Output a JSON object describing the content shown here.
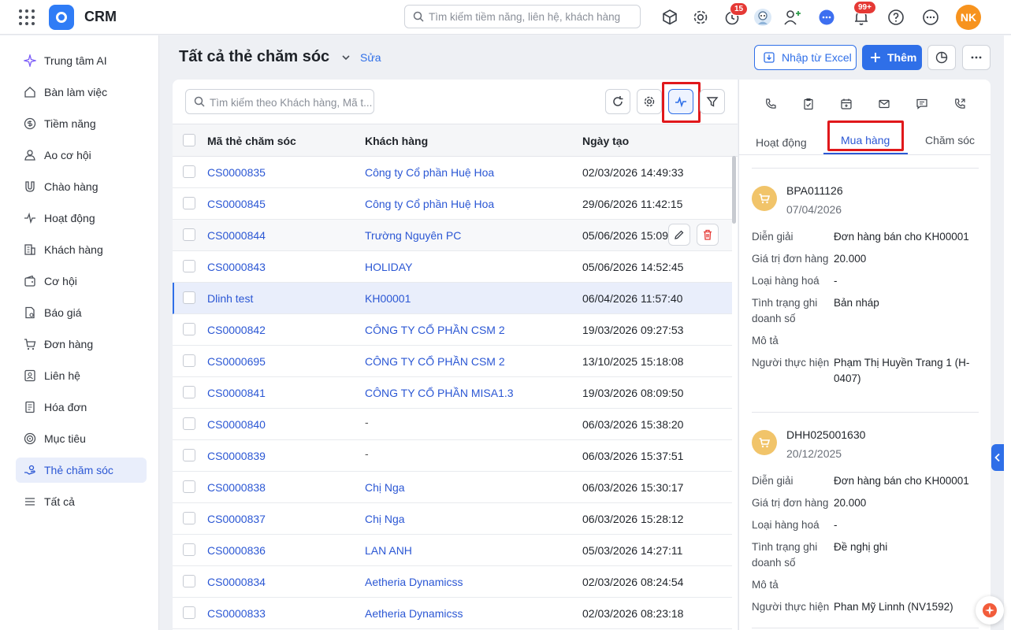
{
  "app": {
    "title": "CRM",
    "search_placeholder": "Tìm kiếm tiềm năng, liên hệ, khách hàng",
    "notifications": {
      "reminders_badge": "15",
      "bell_badge": "99+"
    },
    "user_initials": "NK",
    "accent_color": "#2f6fe8",
    "avatar_color": "#f7931e"
  },
  "sidebar": {
    "items": [
      {
        "label": "Trung tâm AI",
        "icon": "sparkle-icon"
      },
      {
        "label": "Bàn làm việc",
        "icon": "home-icon"
      },
      {
        "label": "Tiềm năng",
        "icon": "dollar-circle-icon"
      },
      {
        "label": "Ao cơ hội",
        "icon": "pool-icon"
      },
      {
        "label": "Chào hàng",
        "icon": "magnet-icon"
      },
      {
        "label": "Hoạt động",
        "icon": "activity-icon"
      },
      {
        "label": "Khách hàng",
        "icon": "building-icon"
      },
      {
        "label": "Cơ hội",
        "icon": "wallet-icon"
      },
      {
        "label": "Báo giá",
        "icon": "quote-doc-icon"
      },
      {
        "label": "Đơn hàng",
        "icon": "cart-icon"
      },
      {
        "label": "Liên hệ",
        "icon": "contact-icon"
      },
      {
        "label": "Hóa đơn",
        "icon": "invoice-icon"
      },
      {
        "label": "Mục tiêu",
        "icon": "target-icon"
      },
      {
        "label": "Thẻ chăm sóc",
        "icon": "care-hand-icon",
        "active": true
      },
      {
        "label": "Tất cả",
        "icon": "menu-icon"
      }
    ]
  },
  "header": {
    "title": "Tất cả thẻ chăm sóc",
    "edit_label": "Sửa",
    "import_label": "Nhập từ Excel",
    "add_label": "Thêm"
  },
  "list": {
    "search_placeholder": "Tìm kiếm theo Khách hàng, Mã t...",
    "columns": [
      "Mã thẻ chăm sóc",
      "Khách hàng",
      "Ngày tạo"
    ],
    "rows": [
      {
        "code": "CS0000835",
        "customer": "Công ty Cổ phần Huệ Hoa",
        "created": "02/03/2026 14:49:33"
      },
      {
        "code": "CS0000845",
        "customer": "Công ty Cổ phần Huệ Hoa",
        "created": "29/06/2026 11:42:15"
      },
      {
        "code": "CS0000844",
        "customer": "Trường Nguyên PC",
        "created": "05/06/2026 15:09:00"
      },
      {
        "code": "CS0000843",
        "customer": "HOLIDAY",
        "created": "05/06/2026 14:52:45"
      },
      {
        "code": "Dlinh test",
        "customer": "KH00001",
        "created": "06/04/2026 11:57:40"
      },
      {
        "code": "CS0000842",
        "customer": "CÔNG TY CỔ PHẦN CSM 2",
        "created": "19/03/2026 09:27:53"
      },
      {
        "code": "CS0000695",
        "customer": "CÔNG TY CỔ PHẦN CSM 2",
        "created": "13/10/2025 15:18:08"
      },
      {
        "code": "CS0000841",
        "customer": "CÔNG TY CỔ PHẦN MISA1.3",
        "created": "19/03/2026 08:09:50"
      },
      {
        "code": "CS0000840",
        "customer": "-",
        "created": "06/03/2026 15:38:20"
      },
      {
        "code": "CS0000839",
        "customer": "-",
        "created": "06/03/2026 15:37:51"
      },
      {
        "code": "CS0000838",
        "customer": "Chị Nga",
        "created": "06/03/2026 15:30:17"
      },
      {
        "code": "CS0000837",
        "customer": "Chị Nga",
        "created": "06/03/2026 15:28:12"
      },
      {
        "code": "CS0000836",
        "customer": "LAN ANH",
        "created": "05/03/2026 14:27:11"
      },
      {
        "code": "CS0000834",
        "customer": "Aetheria Dynamicss",
        "created": "02/03/2026 08:24:54"
      },
      {
        "code": "CS0000833",
        "customer": "Aetheria Dynamicss",
        "created": "02/03/2026 08:23:18"
      }
    ]
  },
  "detail": {
    "tabs": [
      "Hoạt động",
      "Mua hàng",
      "Chăm sóc"
    ],
    "active_tab": "Mua hàng",
    "field_labels": {
      "description": "Diễn giải",
      "order_value": "Giá trị đơn hàng",
      "goods_type": "Loại hàng hoá",
      "sales_status_1": "Tình trạng ghi",
      "sales_status_2": "doanh số",
      "note": "Mô tả",
      "performer": "Người thực hiện"
    },
    "orders": [
      {
        "code": "BPA011126",
        "date": "07/04/2026",
        "description": "Đơn hàng bán cho KH00001",
        "order_value": "20.000",
        "goods_type": "-",
        "sales_status": "Bản nháp",
        "performer": "Phạm Thị Huyền Trang 1 (H-0407)"
      },
      {
        "code": "DHH025001630",
        "date": "20/12/2025",
        "description": "Đơn hàng bán cho KH00001",
        "order_value": "20.000",
        "goods_type": "-",
        "sales_status": "Đề nghị ghi",
        "performer": "Phan Mỹ Linnh (NV1592)"
      }
    ]
  }
}
